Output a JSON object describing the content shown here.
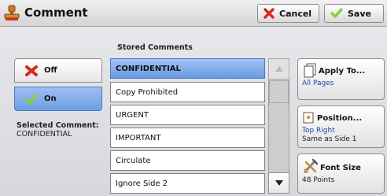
{
  "header": {
    "title": "Comment",
    "cancel_label": "Cancel",
    "save_label": "Save"
  },
  "mode": {
    "off_label": "Off",
    "on_label": "On",
    "selected": "On"
  },
  "selected_comment": {
    "label": "Selected Comment:",
    "value": "CONFIDENTIAL"
  },
  "stored_comments": {
    "label": "Stored Comments",
    "items": [
      "CONFIDENTIAL",
      "Copy Prohibited",
      "URGENT",
      "IMPORTANT",
      "Circulate",
      "Ignore Side 2"
    ],
    "selected": "CONFIDENTIAL"
  },
  "options": {
    "apply_to": {
      "title": "Apply To...",
      "value": "All Pages"
    },
    "position": {
      "title": "Position...",
      "value": "Top Right",
      "value2": "Same as Side 1"
    },
    "font_size": {
      "title": "Font Size",
      "value": "48 Points"
    }
  },
  "colors": {
    "selected_blue": "#6d9ee4",
    "value_blue": "#1b44a8",
    "cancel_red": "#d42a1a",
    "save_green": "#8ccc3c"
  },
  "icons": {
    "title": "stamp-icon",
    "cancel": "x-icon",
    "save": "checkmark-icon",
    "apply_to": "pages-icon",
    "position": "position-square-icon",
    "font_size": "font-tools-icon"
  }
}
